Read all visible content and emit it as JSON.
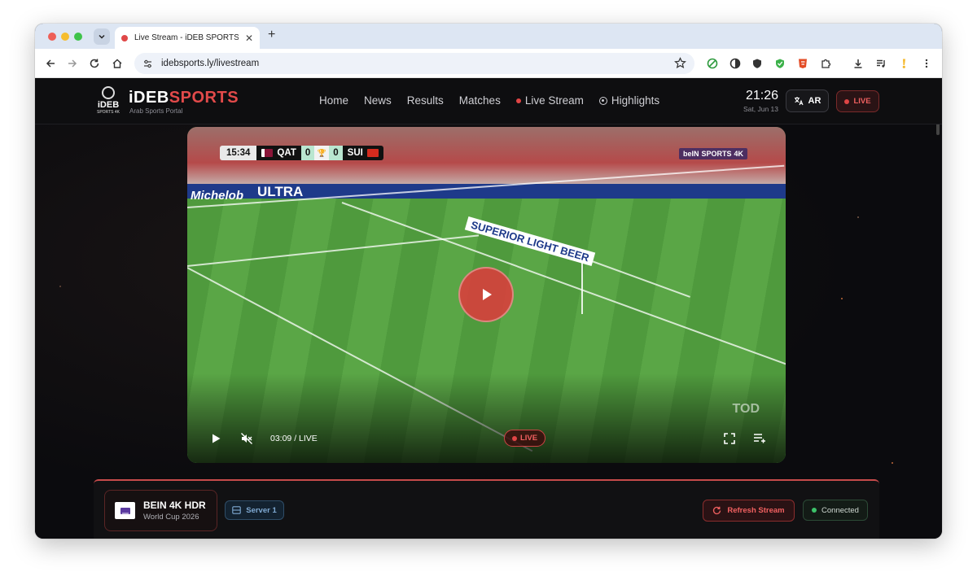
{
  "browser": {
    "tab_title": "Live Stream - iDEB SPORTS",
    "url": "idebsports.ly/livestream",
    "icons": [
      "back-icon",
      "forward-icon",
      "reload-icon",
      "home-icon",
      "site-info-icon",
      "bookmark-star-icon",
      "download-icon",
      "media-icon",
      "menu-icon"
    ]
  },
  "site": {
    "logo_text": "iDEB",
    "logo_sub": "SPORTS 4K",
    "brand_a": "iDEB",
    "brand_b": "SPORTS",
    "tagline": "Arab Sports Portal",
    "nav": [
      {
        "label": "Home"
      },
      {
        "label": "News"
      },
      {
        "label": "Results"
      },
      {
        "label": "Matches"
      },
      {
        "label": "Live Stream",
        "active": true
      },
      {
        "label": "Highlights"
      }
    ],
    "time": "21:26",
    "date": "Sat, Jun 13",
    "lang_label": "AR",
    "live_label": "LIVE",
    "accent_color": "#e24a4a"
  },
  "video": {
    "match_clock": "15:34",
    "home_team": "QAT",
    "home_score": "0",
    "away_team": "SUI",
    "away_score": "0",
    "broadcaster_a": "beIN",
    "broadcaster_b": "SPORTS",
    "broadcaster_c": "4K",
    "ad_1": "Michelob",
    "ad_2": "ULTRA",
    "ad_3": "SUPERIOR LIGHT BEER",
    "watermark": "TOD",
    "player_time": "03:09 / LIVE",
    "live_label": "LIVE"
  },
  "panel": {
    "channel_name": "BEIN 4K HDR",
    "channel_sub": "World Cup 2026",
    "server_label": "Server 1",
    "refresh_label": "Refresh Stream",
    "status_label": "Connected"
  }
}
